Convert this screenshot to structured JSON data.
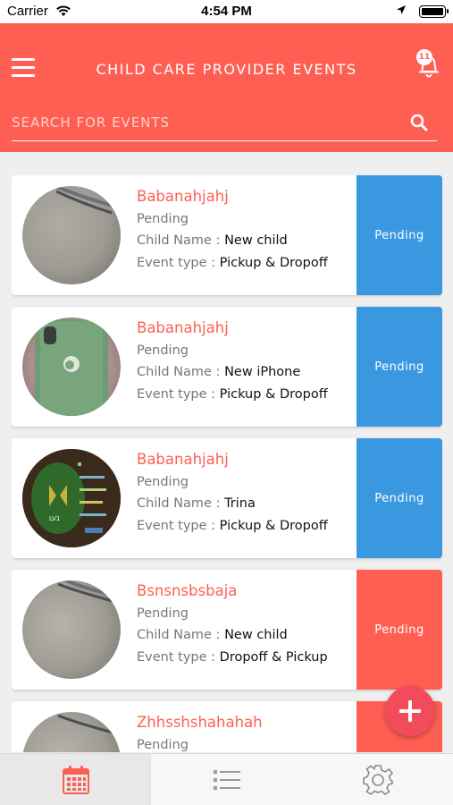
{
  "status_bar": {
    "carrier": "Carrier",
    "time": "4:54 PM"
  },
  "header": {
    "title": "CHILD CARE PROVIDER EVENTS",
    "notification_count": "11",
    "search_placeholder": "SEARCH FOR EVENTS"
  },
  "labels": {
    "child_name": "Child Name : ",
    "event_type": "Event type : "
  },
  "colors": {
    "primary": "#ff5f52",
    "pending_blue": "#3a98e0",
    "fab": "#f14b5c"
  },
  "events": [
    {
      "name": "Babanahjahj",
      "status": "Pending",
      "child": "New child",
      "type": "Pickup & Dropoff",
      "badge": "Pending",
      "badge_color": "blue",
      "avatar": "concrete-photo"
    },
    {
      "name": "Babanahjahj",
      "status": "Pending",
      "child": "New iPhone",
      "type": "Pickup & Dropoff",
      "badge": "Pending",
      "badge_color": "blue",
      "avatar": "green-phone-photo"
    },
    {
      "name": "Babanahjahj",
      "status": "Pending",
      "child": "Trina",
      "type": "Pickup & Dropoff",
      "badge": "Pending",
      "badge_color": "blue",
      "avatar": "game-screen-photo"
    },
    {
      "name": "Bsnsnsbsbaja",
      "status": "Pending",
      "child": "New child",
      "type": "Dropoff & Pickup",
      "badge": "Pending",
      "badge_color": "red",
      "avatar": "concrete-photo"
    },
    {
      "name": "Zhhsshshahahah",
      "status": "Pending",
      "child": "",
      "type": "",
      "badge": "",
      "badge_color": "red",
      "avatar": "concrete-photo"
    }
  ],
  "tabs": [
    {
      "icon": "calendar-icon",
      "active": true
    },
    {
      "icon": "list-icon",
      "active": false
    },
    {
      "icon": "gear-icon",
      "active": false
    }
  ]
}
